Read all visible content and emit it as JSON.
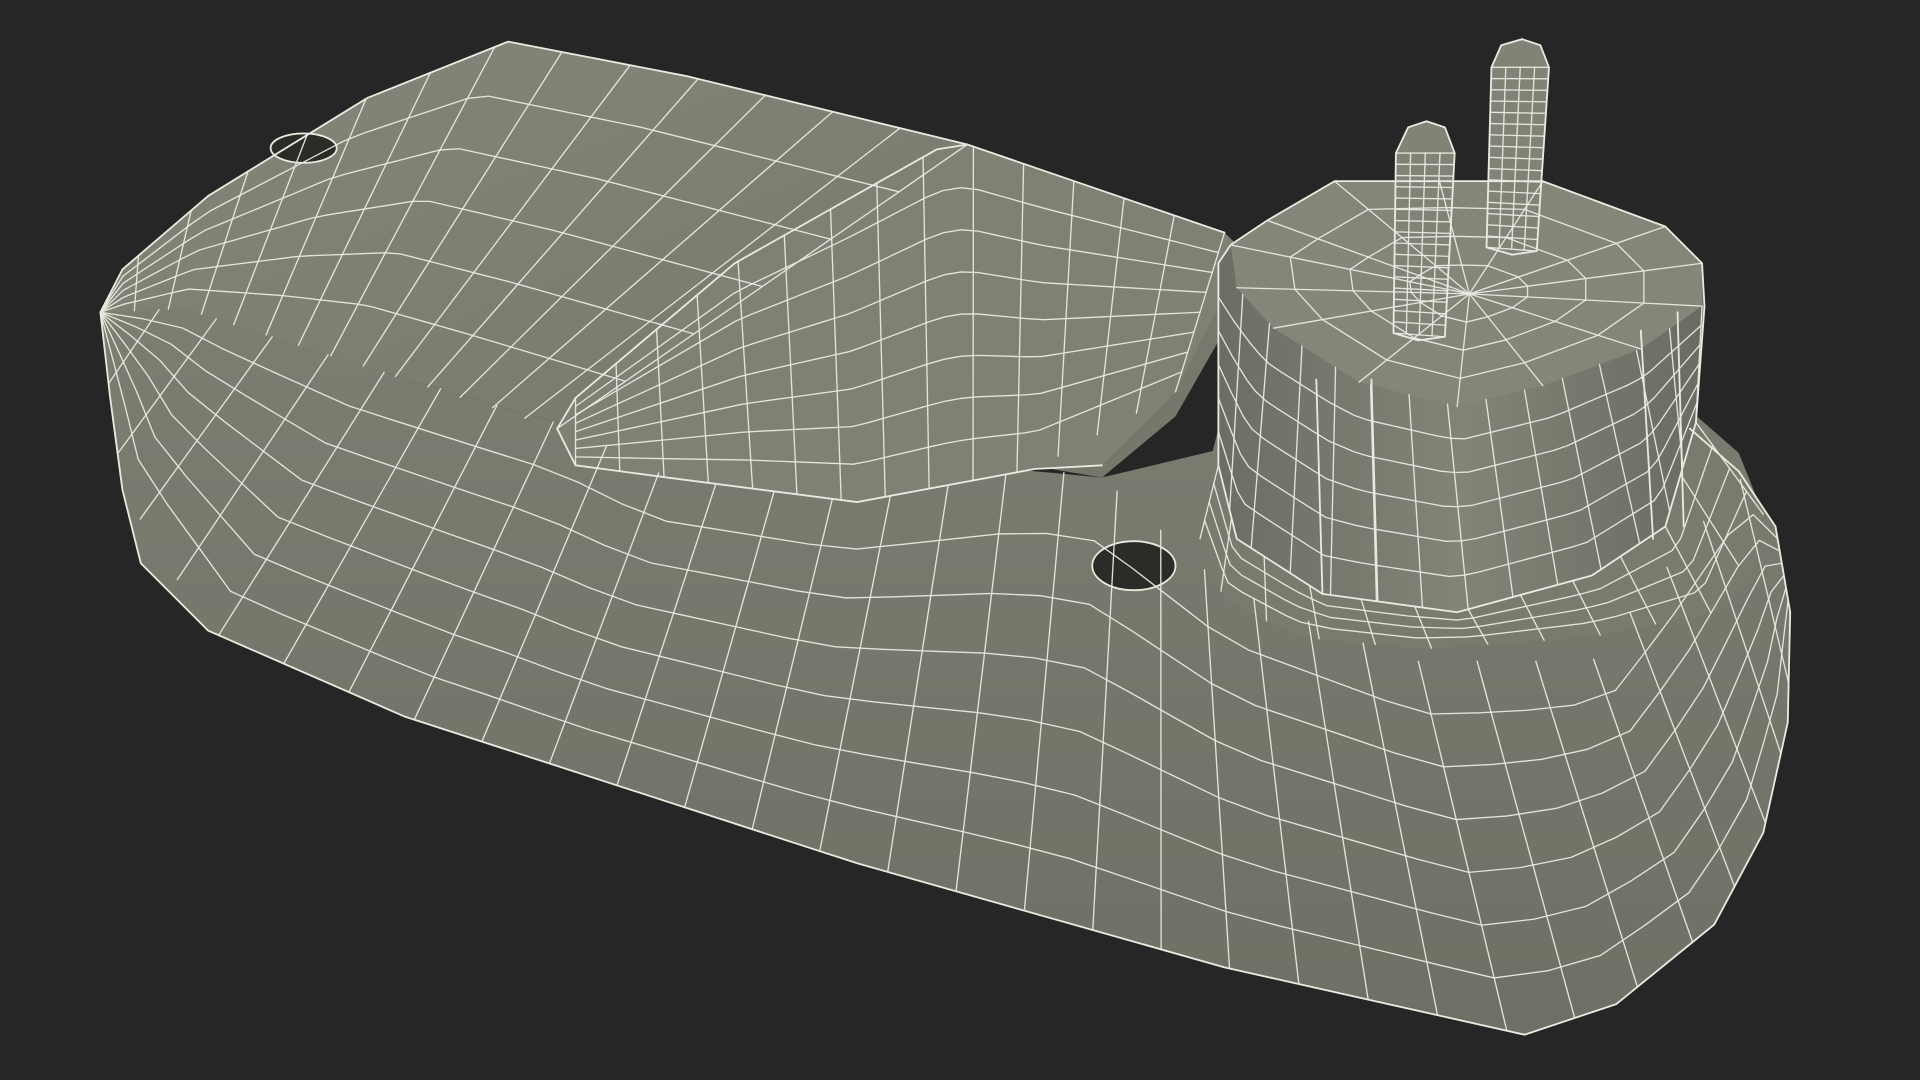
{
  "scene": {
    "background_color": "#262626",
    "mesh_color": "#7b7d70",
    "wire_color": "#e9e9df",
    "shade_color": "#5f6156",
    "hole_color": "#2a2c28"
  }
}
